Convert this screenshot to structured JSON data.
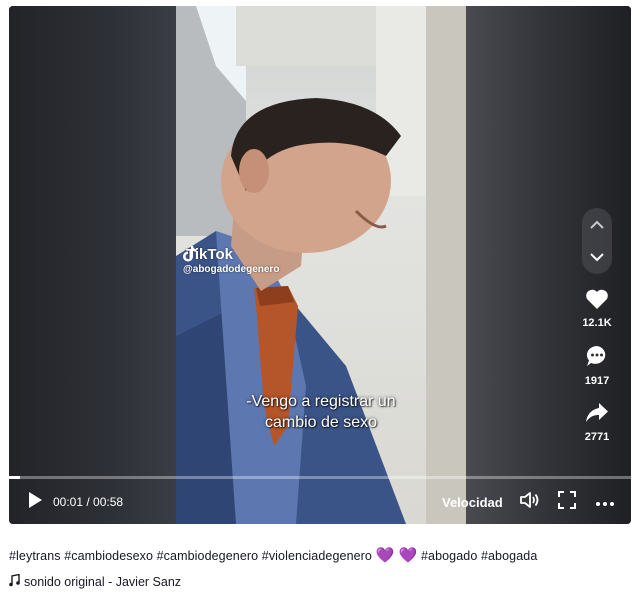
{
  "video": {
    "watermark_brand": "TikTok",
    "watermark_user": "@abogadodegenero",
    "caption_line1": "-Vengo a registrar un",
    "caption_line2": "cambio de sexo"
  },
  "side_actions": {
    "likes": "12.1K",
    "comments": "1917",
    "shares": "2771"
  },
  "controls": {
    "current_time": "00:01",
    "duration": "00:58",
    "time_display": "00:01 / 00:58",
    "speed_label": "Velocidad",
    "progress_fraction": 0.017
  },
  "description": {
    "tags_before_hearts": "#leytrans #cambiodesexo #cambiodegenero #violenciadegenero",
    "hearts": "💜 💜",
    "tags_after_hearts": "#abogado #abogada"
  },
  "sound": {
    "label": "sonido original - Javier Sanz"
  },
  "colors": {
    "heart_purple": "#8f6ad8",
    "text_dark": "#161823",
    "tie": "#b5562a",
    "suit": "#3b5488"
  },
  "icons": [
    "tiktok-logo-icon",
    "chevron-up-icon",
    "chevron-down-icon",
    "heart-icon",
    "comment-icon",
    "share-icon",
    "play-icon",
    "volume-icon",
    "fullscreen-icon",
    "more-icon",
    "music-note-icon"
  ]
}
